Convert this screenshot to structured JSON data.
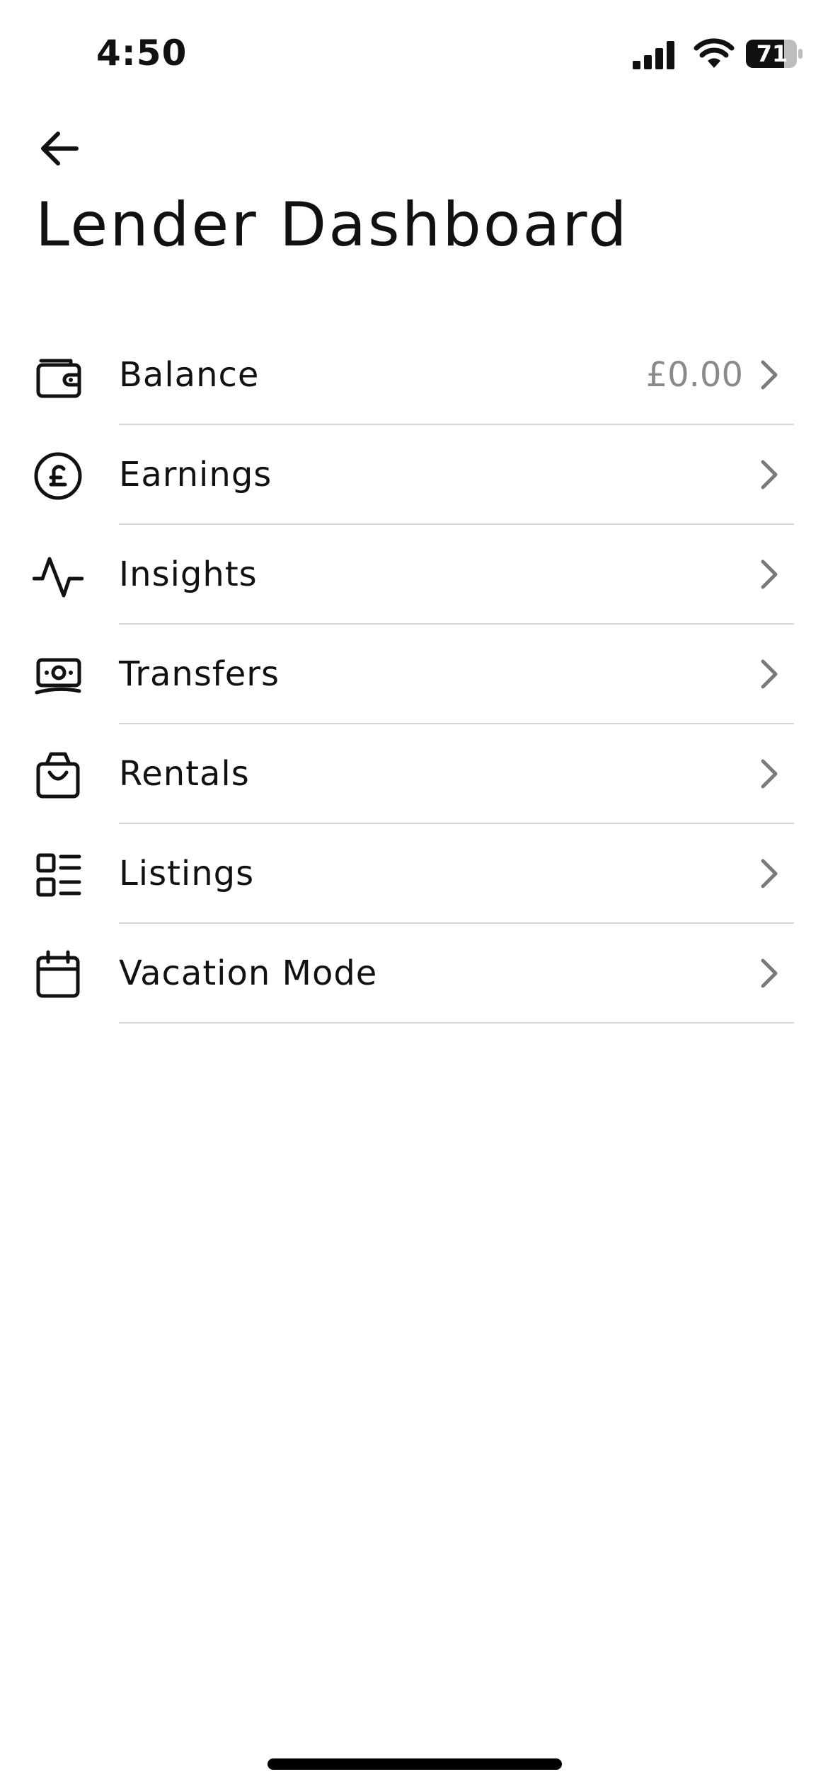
{
  "status_bar": {
    "time": "4:50",
    "battery_level": "71",
    "icons": [
      "signal-icon",
      "wifi-icon",
      "battery-icon"
    ]
  },
  "header": {
    "back_icon": "arrow-left-icon",
    "title": "Lender Dashboard"
  },
  "menu": {
    "items": [
      {
        "label": "Balance",
        "value": "£0.00",
        "icon": "wallet-icon"
      },
      {
        "label": "Earnings",
        "value": "",
        "icon": "pound-circle-icon"
      },
      {
        "label": "Insights",
        "value": "",
        "icon": "activity-icon"
      },
      {
        "label": "Transfers",
        "value": "",
        "icon": "cash-icon"
      },
      {
        "label": "Rentals",
        "value": "",
        "icon": "shopping-bag-icon"
      },
      {
        "label": "Listings",
        "value": "",
        "icon": "list-icon"
      },
      {
        "label": "Vacation Mode",
        "value": "",
        "icon": "calendar-icon"
      }
    ]
  },
  "colors": {
    "text": "#111111",
    "muted": "#8a8a8a",
    "divider": "#d6d6d6",
    "background": "#ffffff"
  }
}
